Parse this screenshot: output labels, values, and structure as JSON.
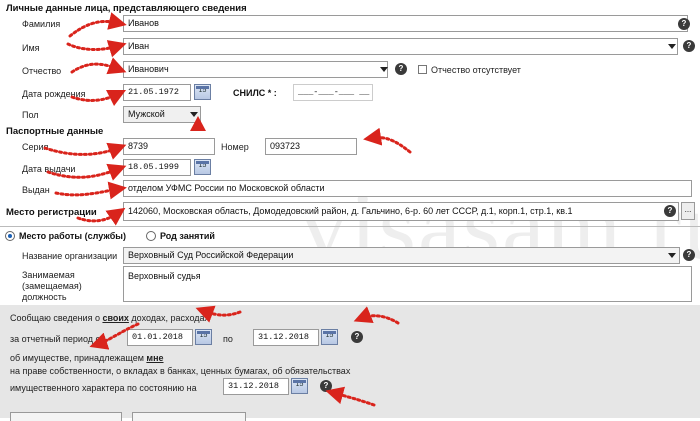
{
  "sections": {
    "personal": "Личные данные лица, представляющего сведения",
    "passport": "Паспортные данные",
    "registration": "Место регистрации"
  },
  "personal": {
    "surname_label": "Фамилия",
    "surname_value": "Иванов",
    "name_label": "Имя",
    "name_value": "Иван",
    "patronymic_label": "Отчество",
    "patronymic_value": "Иванович",
    "no_patronymic_label": "Отчество отсутствует",
    "birthdate_label": "Дата рождения",
    "birthdate_value": "21.05.1972",
    "snils_label": "СНИЛС * :",
    "snils_value": "___-___-___ __",
    "gender_label": "Пол",
    "gender_value": "Мужской"
  },
  "passport": {
    "series_label": "Серия",
    "series_value": "8739",
    "number_label": "Номер",
    "number_value": "093723",
    "issue_date_label": "Дата выдачи",
    "issue_date_value": "18.05.1999",
    "issued_by_label": "Выдан",
    "issued_by_value": "отделом УФМС России по Московской области"
  },
  "registration": {
    "address_value": "142060, Московская область, Домодедовский район, д. Гальчино, 6-р. 60 лет СССР, д.1, корп.1, стр.1, кв.1",
    "more_button": "..."
  },
  "work": {
    "radio_work": "Место работы (службы)",
    "radio_activity": "Род занятий",
    "org_label": "Название организации",
    "org_value": "Верховный Суд Российской Федерации",
    "position_label_1": "Занимаемая",
    "position_label_2": "(замещаемая)",
    "position_label_3": "должность",
    "position_value": "Верховный судья"
  },
  "report": {
    "line1_a": "Сообщаю сведения о ",
    "line1_own": "своих",
    "line1_b": " доходах, расходах",
    "period_label": "за отчетный период с",
    "period_from": "01.01.2018",
    "period_to_label": "по",
    "period_to": "31.12.2018",
    "property_a": "об имуществе, принадлежащем ",
    "property_me": "мне",
    "property_line2": "на праве собственности, о вкладах в банках, ценных бумагах, об обязательствах",
    "property_line3": "имущественного характера по состоянию на",
    "state_date": "31.12.2018"
  },
  "icons": {
    "help": "?",
    "calendar": "15"
  },
  "watermark": "visasam.ru",
  "colors": {
    "arrow": "#d9241c",
    "radio": "#1a5fb4",
    "panel": "#e6e6e6"
  }
}
